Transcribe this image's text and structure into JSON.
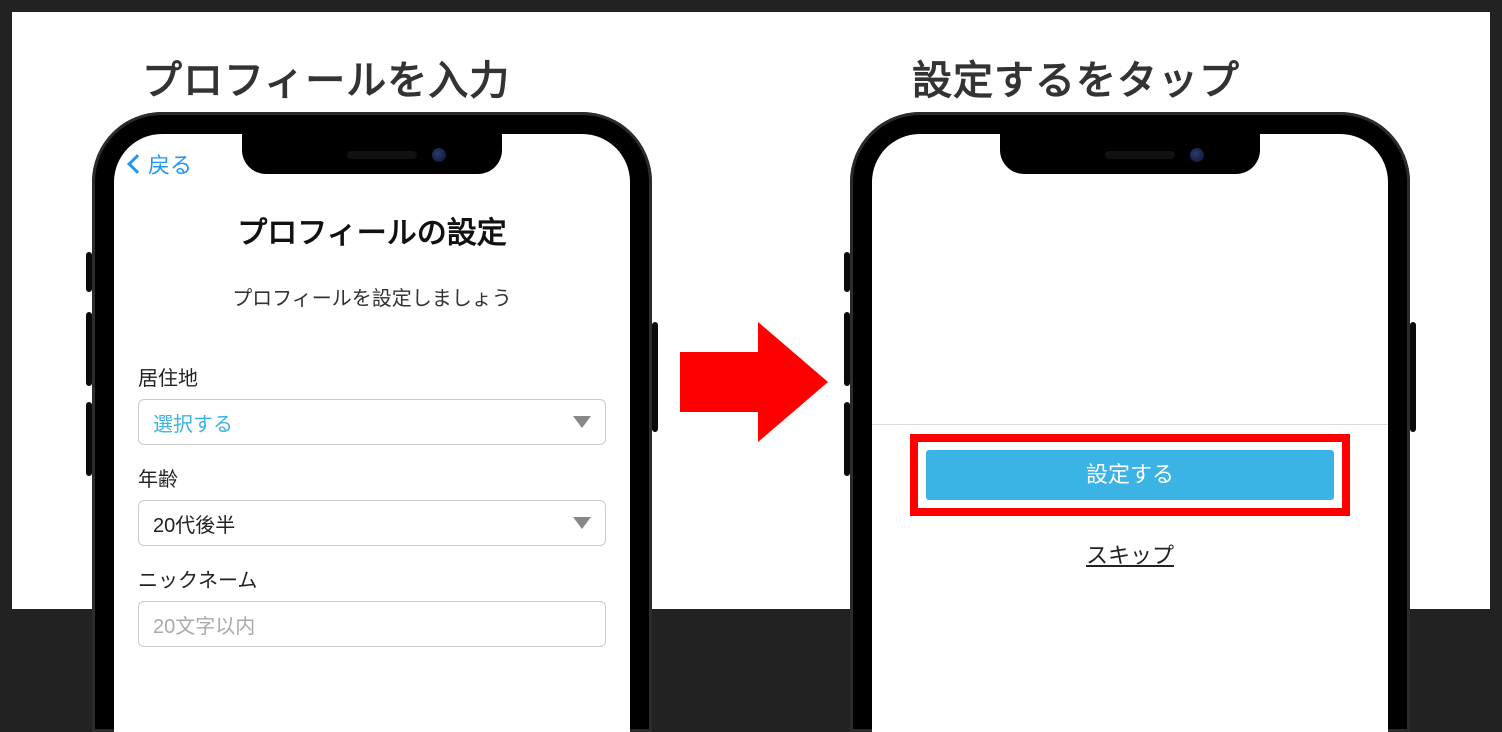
{
  "captions": {
    "left": "プロフィールを入力",
    "right": "設定するをタップ"
  },
  "screen1": {
    "back_label": "戻る",
    "title": "プロフィールの設定",
    "subtitle": "プロフィールを設定しましょう",
    "fields": {
      "residence": {
        "label": "居住地",
        "placeholder": "選択する"
      },
      "age": {
        "label": "年齢",
        "value": "20代後半"
      },
      "nickname": {
        "label": "ニックネーム",
        "placeholder": "20文字以内"
      }
    }
  },
  "screen2": {
    "primary_button": "設定する",
    "skip_label": "スキップ"
  },
  "colors": {
    "accent_blue": "#3bb3e4",
    "highlight_red": "#ff0000",
    "ios_link": "#2196f3"
  }
}
